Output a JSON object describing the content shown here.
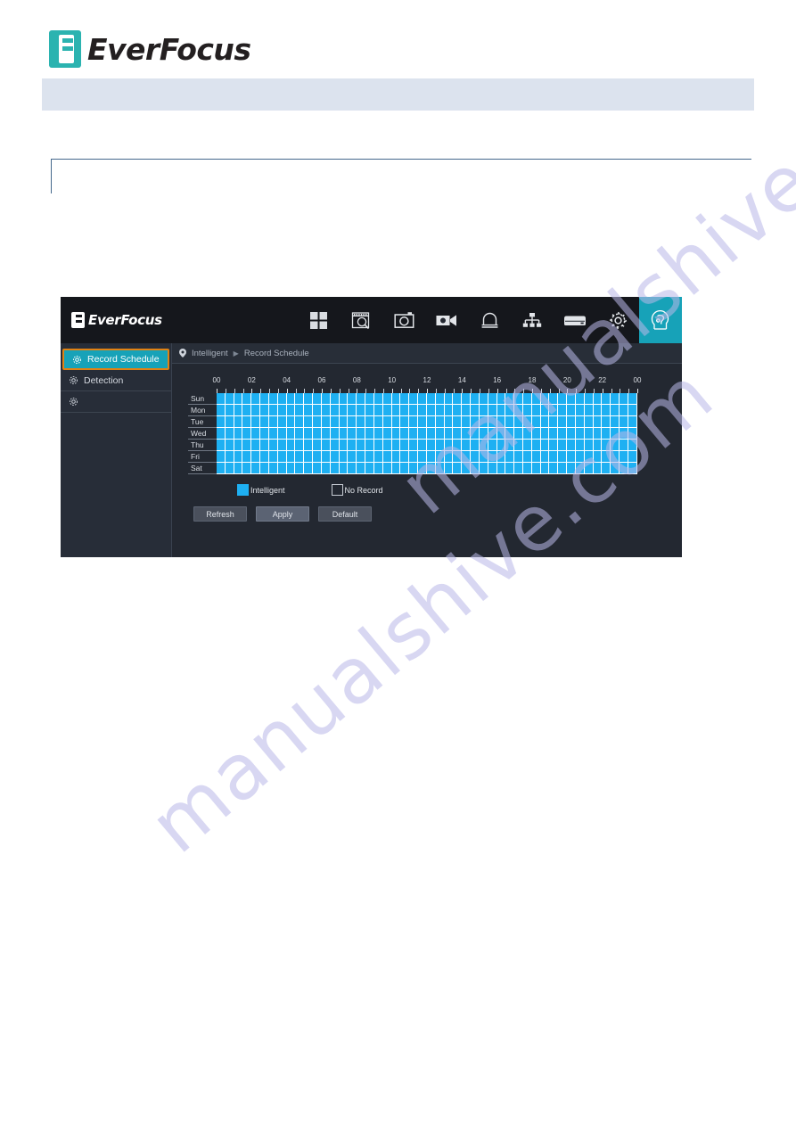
{
  "document": {
    "brand": "EverFocus",
    "band_text": "",
    "note_text": ""
  },
  "watermark": {
    "text": "manualshive.com"
  },
  "device": {
    "brand": "EverFocus",
    "toolbar": {
      "icons": [
        {
          "name": "live-view-grid-icon",
          "label": "Live View",
          "active": false
        },
        {
          "name": "playback-search-icon",
          "label": "Playback",
          "active": false
        },
        {
          "name": "snapshot-camera-icon",
          "label": "Snapshot",
          "active": false
        },
        {
          "name": "video-record-icon",
          "label": "Record",
          "active": false
        },
        {
          "name": "alarm-siren-icon",
          "label": "Alarm",
          "active": false
        },
        {
          "name": "network-tree-icon",
          "label": "Network",
          "active": false
        },
        {
          "name": "storage-disk-icon",
          "label": "Storage",
          "active": false
        },
        {
          "name": "settings-gear-icon",
          "label": "System",
          "active": false
        },
        {
          "name": "intelligent-ai-icon",
          "label": "Intelligent",
          "active": true
        }
      ]
    },
    "sidebar": {
      "items": [
        {
          "label": "Record Schedule",
          "icon": "gear-icon",
          "selected": true
        },
        {
          "label": "Detection",
          "icon": "gear-icon",
          "selected": false
        },
        {
          "label": "",
          "icon": "gear-icon",
          "selected": false
        }
      ]
    },
    "breadcrumb": {
      "pin_icon": "location-pin-icon",
      "root": "Intelligent",
      "separator": "▶",
      "current": "Record Schedule"
    },
    "schedule": {
      "hour_labels": [
        "00",
        "02",
        "04",
        "06",
        "08",
        "10",
        "12",
        "14",
        "16",
        "18",
        "20",
        "22",
        "00"
      ],
      "days": [
        "Sun",
        "Mon",
        "Tue",
        "Wed",
        "Thu",
        "Fri",
        "Sat"
      ],
      "columns_per_day": 48,
      "legend": [
        {
          "label": "Intelligent",
          "swatch": "filled",
          "color": "#1EB0F2"
        },
        {
          "label": "No Record",
          "swatch": "empty",
          "color": "#232831"
        }
      ],
      "coverage": {
        "Sun": "00:00-24:00",
        "Mon": "00:00-24:00",
        "Tue": "00:00-24:00",
        "Wed": "00:00-24:00",
        "Thu": "00:00-24:00",
        "Fri": "00:00-24:00",
        "Sat": "00:00-24:00"
      }
    },
    "buttons": {
      "refresh": "Refresh",
      "apply": "Apply",
      "default": "Default"
    },
    "colors": {
      "accent": "#17A2B8",
      "selection_border": "#E08214",
      "schedule_fill": "#1EB0F2",
      "panel_bg": "#232831",
      "topbar_bg": "#15171C"
    }
  }
}
